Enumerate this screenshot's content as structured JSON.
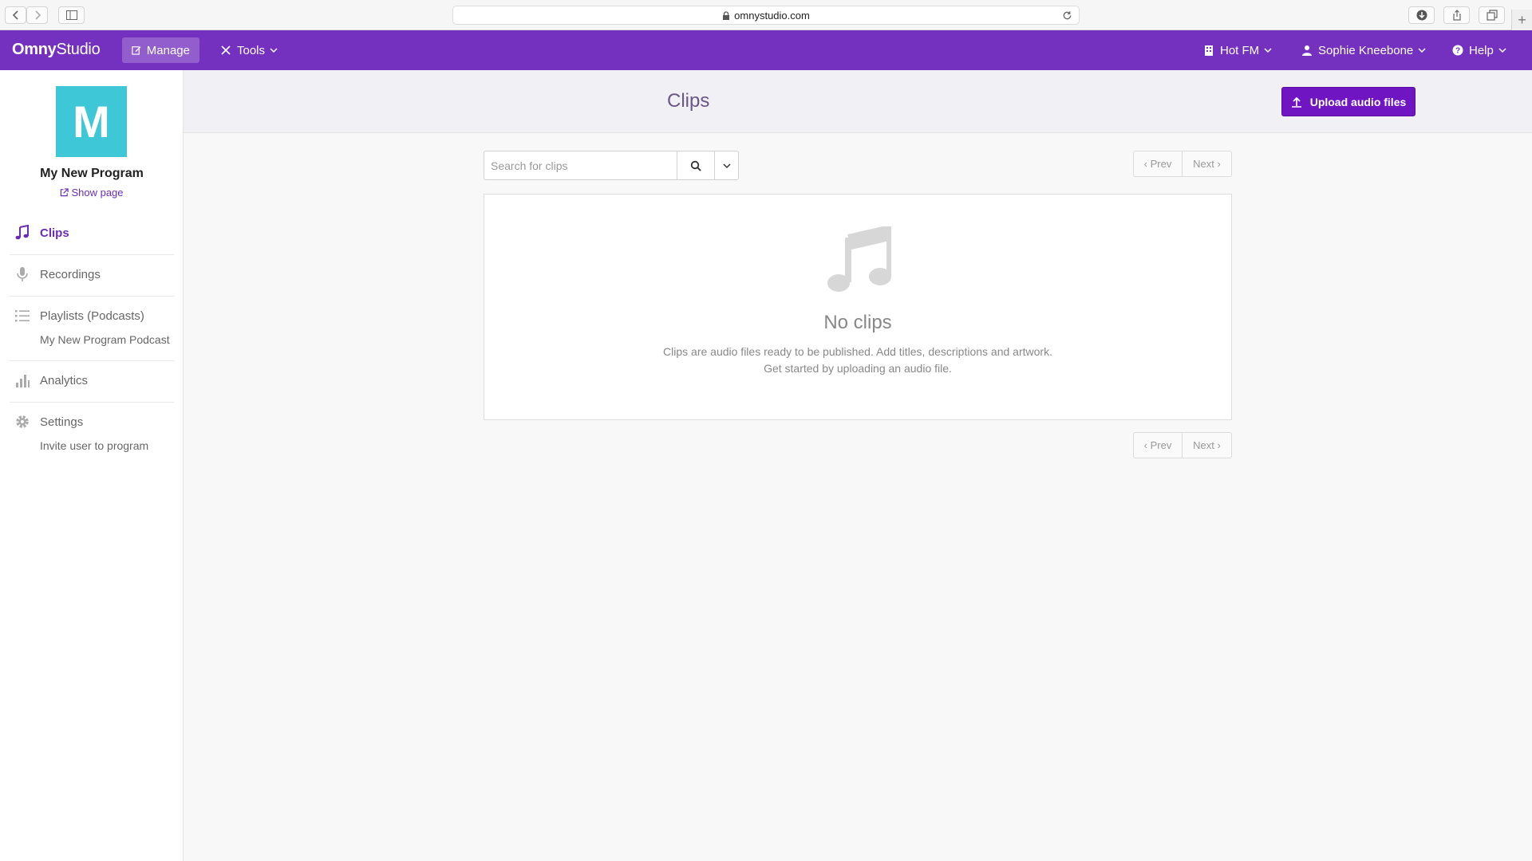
{
  "browser": {
    "url": "omnystudio.com"
  },
  "appnav": {
    "logo_prefix": "Omny",
    "logo_suffix": "Studio",
    "manage_label": "Manage",
    "tools_label": "Tools",
    "station_label": "Hot FM",
    "user_label": "Sophie Kneebone",
    "help_label": "Help"
  },
  "sidebar": {
    "avatar_letter": "M",
    "program_name": "My New Program",
    "show_page_label": "Show page",
    "items": [
      {
        "label": "Clips",
        "icon": "music-note-icon",
        "active": true
      },
      {
        "label": "Recordings",
        "icon": "microphone-icon"
      },
      {
        "label": "Playlists (Podcasts)",
        "icon": "list-icon",
        "sub": "My New Program Podcast"
      },
      {
        "label": "Analytics",
        "icon": "bar-chart-icon"
      },
      {
        "label": "Settings",
        "icon": "gear-icon",
        "sub": "Invite user to program"
      }
    ]
  },
  "header": {
    "title": "Clips",
    "upload_label": "Upload audio files"
  },
  "search": {
    "placeholder": "Search for clips"
  },
  "pager": {
    "prev_label": "‹ Prev",
    "next_label": "Next ›"
  },
  "empty_state": {
    "title": "No clips",
    "line1": "Clips are audio files ready to be published. Add titles, descriptions and artwork.",
    "line2": "Get started by uploading an audio file."
  },
  "colors": {
    "brand_purple": "#7431c0",
    "accent_button": "#7015c2",
    "avatar_teal": "#3ec7d6"
  }
}
